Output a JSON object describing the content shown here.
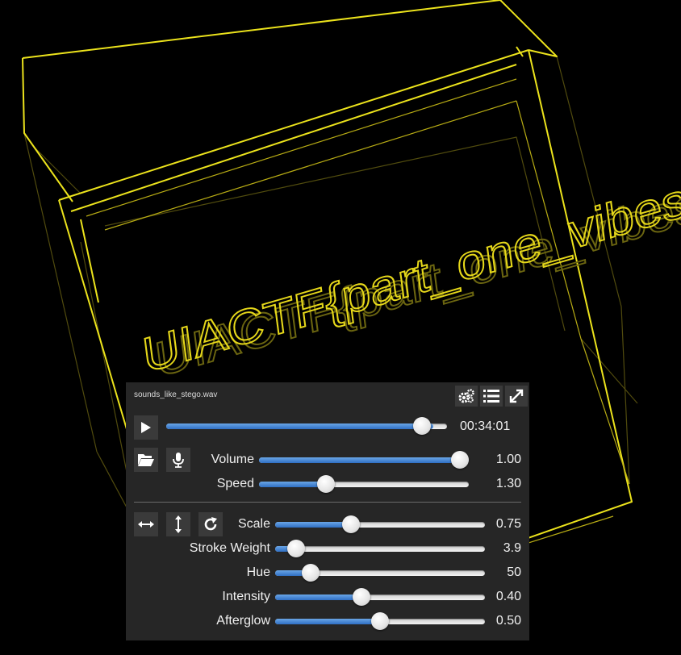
{
  "scene": {
    "flag_text": "UIACTF{part_one_vibes}",
    "accent": "#f2e21a"
  },
  "player": {
    "filename": "sounds_like_stego.wav",
    "time": "00:34:01",
    "progress": 0.95,
    "toolbar": {
      "settings_icon": "gears-icon",
      "playlist_icon": "list-icon",
      "fullscreen_icon": "expand-icon"
    },
    "play_icon": "play-icon",
    "open_icon": "folder-open-icon",
    "mic_icon": "microphone-icon",
    "sliders_audio": [
      {
        "label": "Volume",
        "value": "1.00",
        "fraction": 1.0
      },
      {
        "label": "Speed",
        "value": "1.30",
        "fraction": 0.32
      }
    ],
    "transform_icons": [
      "arrows-horizontal-icon",
      "arrows-vertical-icon",
      "rotate-icon"
    ],
    "sliders_visual": [
      {
        "label": "Scale",
        "value": "0.75",
        "fraction": 0.36
      },
      {
        "label": "Stroke Weight",
        "value": "3.9",
        "fraction": 0.1
      },
      {
        "label": "Hue",
        "value": "50",
        "fraction": 0.17
      },
      {
        "label": "Intensity",
        "value": "0.40",
        "fraction": 0.41
      },
      {
        "label": "Afterglow",
        "value": "0.50",
        "fraction": 0.5
      }
    ],
    "colors": {
      "fill": "#3f7fd3",
      "panel": "#262626"
    }
  }
}
